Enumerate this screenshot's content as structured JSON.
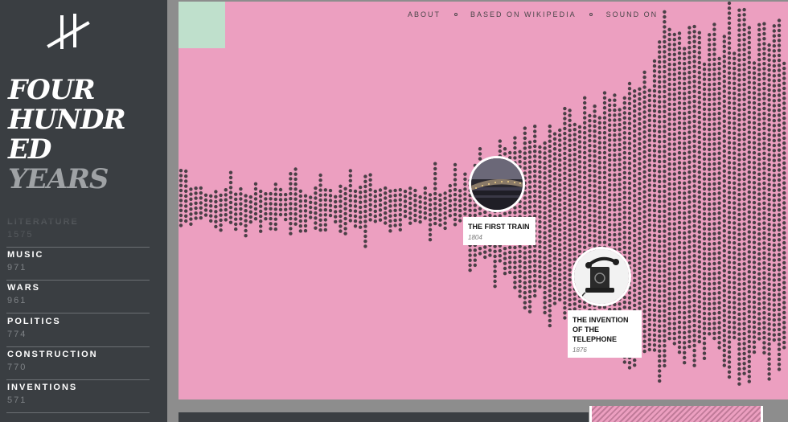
{
  "site": {
    "title_lines": [
      "FOUR",
      "HUNDR",
      "ED",
      "YEARS"
    ]
  },
  "nav": {
    "about": "ABOUT",
    "based_on": "BASED ON WIKIPEDIA",
    "sound": "SOUND ON"
  },
  "categories": [
    {
      "name": "LITERATURE",
      "count": "1575"
    },
    {
      "name": "MUSIC",
      "count": "971"
    },
    {
      "name": "WARS",
      "count": "961"
    },
    {
      "name": "POLITICS",
      "count": "774"
    },
    {
      "name": "CONSTRUCTION",
      "count": "770"
    },
    {
      "name": "INVENTIONS",
      "count": "571"
    }
  ],
  "events": [
    {
      "title": "THE FIRST TRAIN",
      "year": "1804",
      "image": "bridge-train-photo"
    },
    {
      "title": "THE INVENTION OF THE TELEPHONE",
      "year": "1876",
      "image": "vintage-telephone-photo"
    }
  ],
  "colors": {
    "sidebar": "#3a3e42",
    "viz_background": "#ec9fc0",
    "dot": "#4a3f46",
    "accent_mint": "#bfe0cc"
  }
}
